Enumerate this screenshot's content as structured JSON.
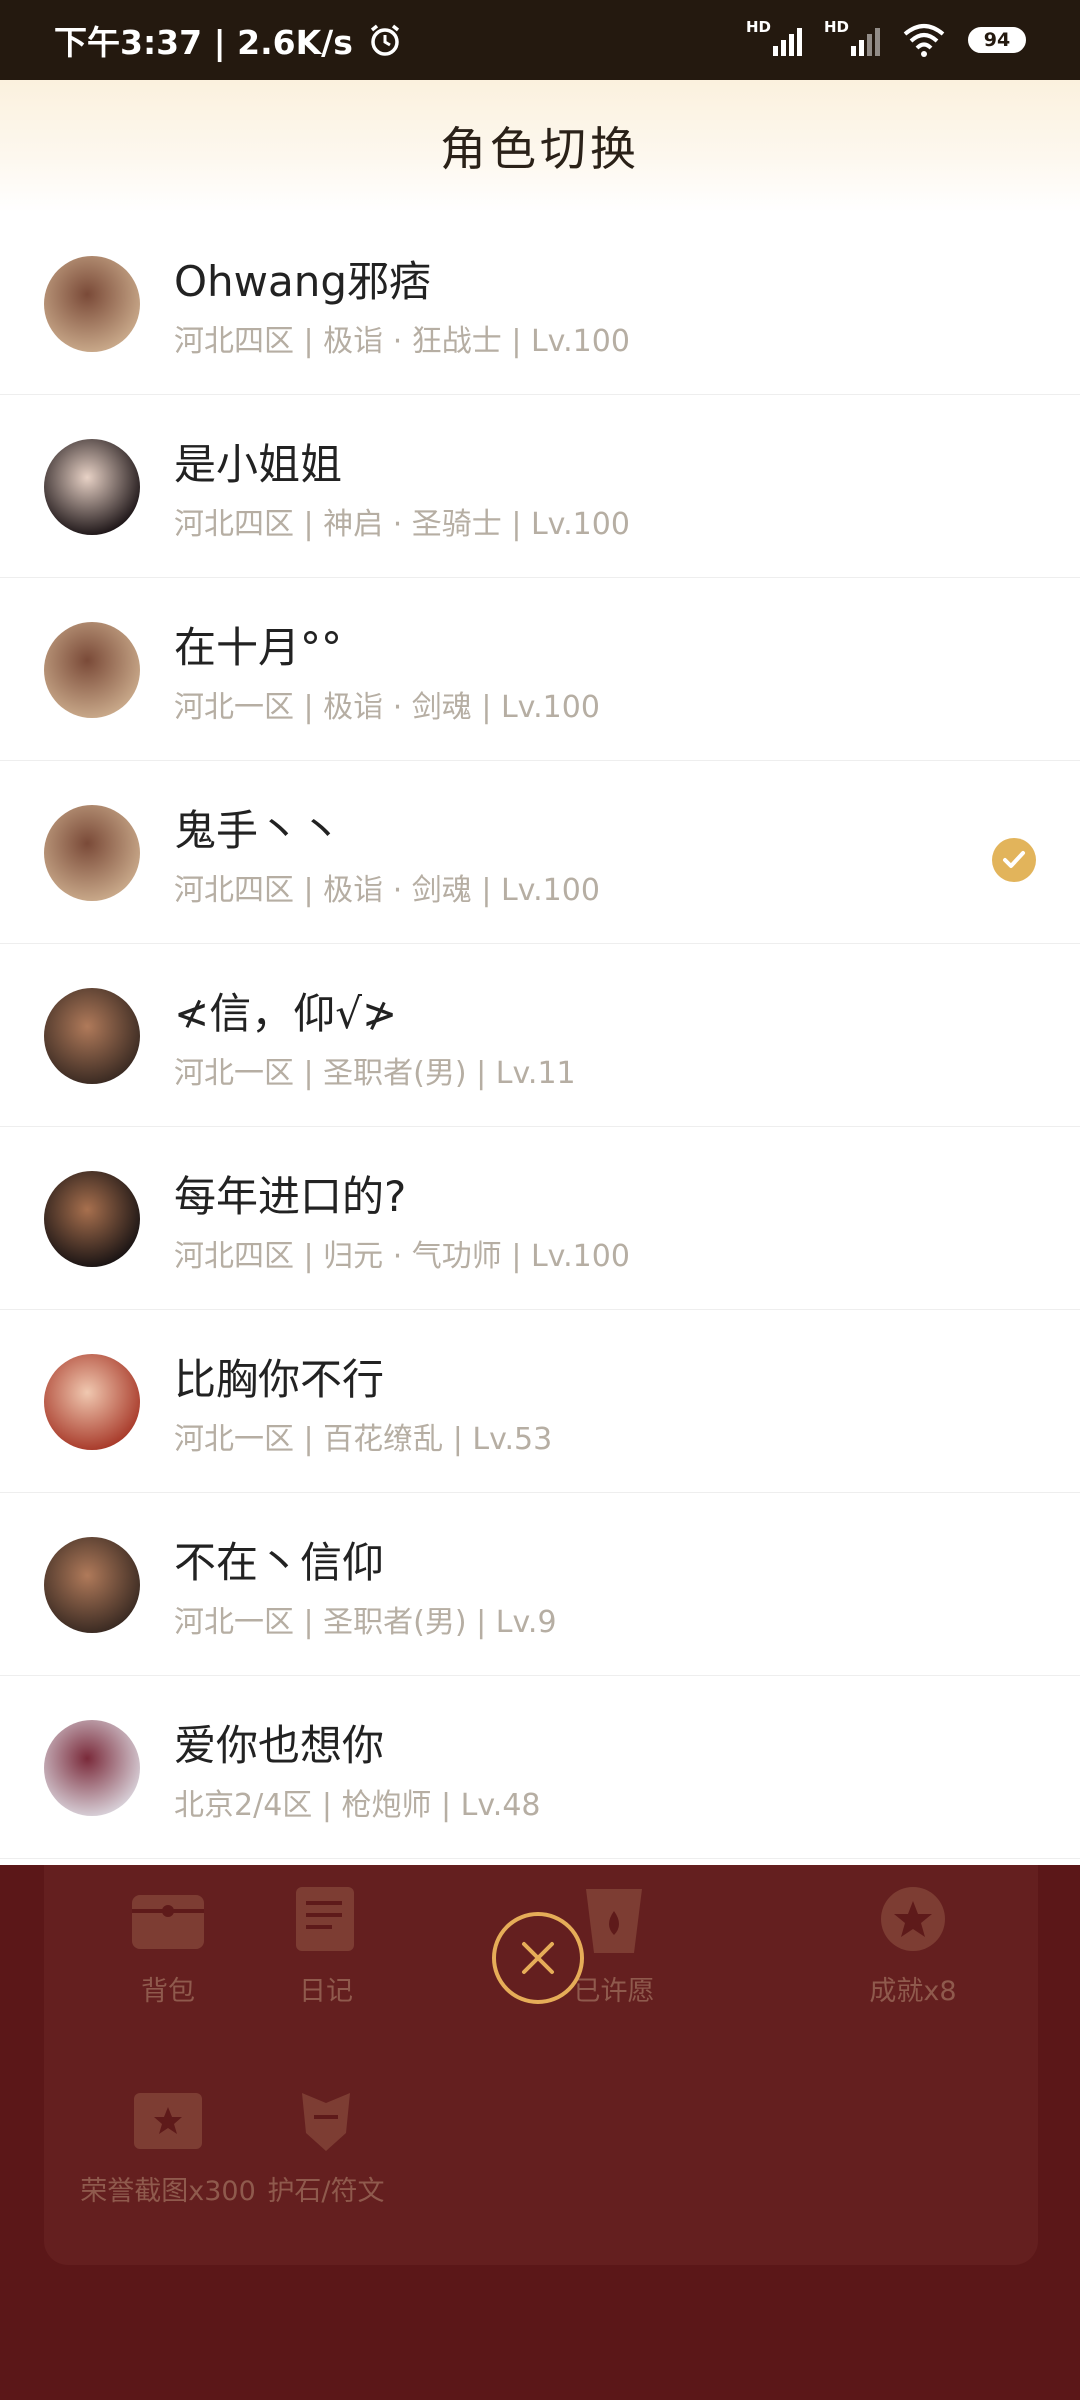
{
  "status_bar": {
    "time_speed": "下午3:37 | 2.6K/s",
    "hd1": "HD",
    "hd2": "HD",
    "battery": "94"
  },
  "header": {
    "title": "角色切换"
  },
  "characters": [
    {
      "name": "Ohwang邪痞",
      "meta": "河北四区 | 极诣 · 狂战士 | Lv.100",
      "selected": false,
      "avatar_colors": [
        "#c9a98a",
        "#7a4a38"
      ]
    },
    {
      "name": "是小姐姐",
      "meta": "河北四区 | 神启 · 圣骑士 | Lv.100",
      "selected": false,
      "avatar_colors": [
        "#1e1618",
        "#e8d2c6"
      ]
    },
    {
      "name": "在十月°°",
      "meta": "河北一区 | 极诣 · 剑魂 | Lv.100",
      "selected": false,
      "avatar_colors": [
        "#c9a98a",
        "#7a4a38"
      ]
    },
    {
      "name": "鬼手丶丶",
      "meta": "河北四区 | 极诣 · 剑魂 | Lv.100",
      "selected": true,
      "avatar_colors": [
        "#c9a98a",
        "#7a4a38"
      ]
    },
    {
      "name": "≮信，仰√≯",
      "meta": "河北一区 | 圣职者(男) | Lv.11",
      "selected": false,
      "avatar_colors": [
        "#3a2a22",
        "#b07a5a"
      ]
    },
    {
      "name": "每年进口的?",
      "meta": "河北四区 | 归元 · 气功师 | Lv.100",
      "selected": false,
      "avatar_colors": [
        "#1a1414",
        "#a8704e"
      ]
    },
    {
      "name": "比胸你不行",
      "meta": "河北一区 | 百花缭乱 | Lv.53",
      "selected": false,
      "avatar_colors": [
        "#a83a2a",
        "#f0c8b0"
      ]
    },
    {
      "name": "不在丶信仰",
      "meta": "河北一区 | 圣职者(男) | Lv.9",
      "selected": false,
      "avatar_colors": [
        "#3a2a22",
        "#b07a5a"
      ]
    },
    {
      "name": "爱你也想你",
      "meta": "北京2/4区 | 枪炮师 | Lv.48",
      "selected": false,
      "avatar_colors": [
        "#d8d0d8",
        "#7a2a3a"
      ]
    }
  ],
  "bottom_grid": [
    {
      "label": "背包",
      "icon": "bag-icon"
    },
    {
      "label": "日记",
      "icon": "diary-icon"
    },
    {
      "label": "已许愿",
      "icon": "wish-icon"
    },
    {
      "label": "成就x8",
      "icon": "achievement-icon"
    },
    {
      "label": "荣誉截图x300",
      "icon": "screenshot-icon"
    },
    {
      "label": "护石/符文",
      "icon": "talisman-icon"
    }
  ],
  "colors": {
    "accent": "#e2b45b",
    "panel_bg": "#5e1718",
    "meta_text": "#b6aea3"
  }
}
